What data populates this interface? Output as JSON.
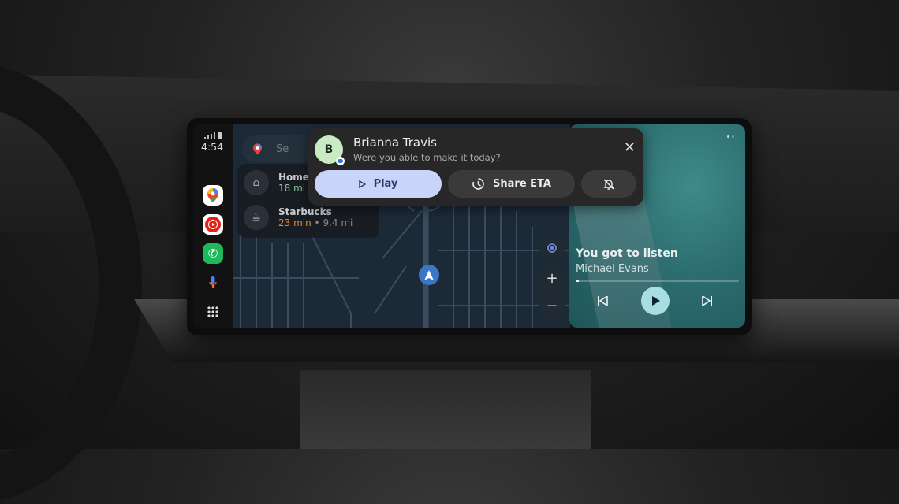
{
  "status": {
    "time": "4:54"
  },
  "rail": {
    "apps": [
      {
        "name": "Google Maps"
      },
      {
        "name": "YouTube Music"
      },
      {
        "name": "Phone"
      },
      {
        "name": "Assistant"
      },
      {
        "name": "App launcher"
      }
    ]
  },
  "map": {
    "search_placeholder": "Se",
    "destinations": [
      {
        "name": "Home",
        "eta": "18 mi",
        "eta_color": "#7fc98d"
      },
      {
        "name": "Starbucks",
        "eta": "23 min",
        "distance": "• 9.4 mi",
        "eta_color": "#d98a3a"
      }
    ],
    "controls": {
      "zoom_in": "+",
      "zoom_out": "−"
    }
  },
  "notification": {
    "avatar_initial": "B",
    "sender": "Brianna Travis",
    "message": "Were you able to make it today?",
    "actions": {
      "play": "Play",
      "share_eta": "Share ETA"
    }
  },
  "media": {
    "title": "You got to listen",
    "artist": "Michael Evans",
    "progress_percent": 2
  },
  "colors": {
    "play_button": "#c9d4fb",
    "media_play": "#a8dde3",
    "nav_arrow": "#3b77c7"
  }
}
